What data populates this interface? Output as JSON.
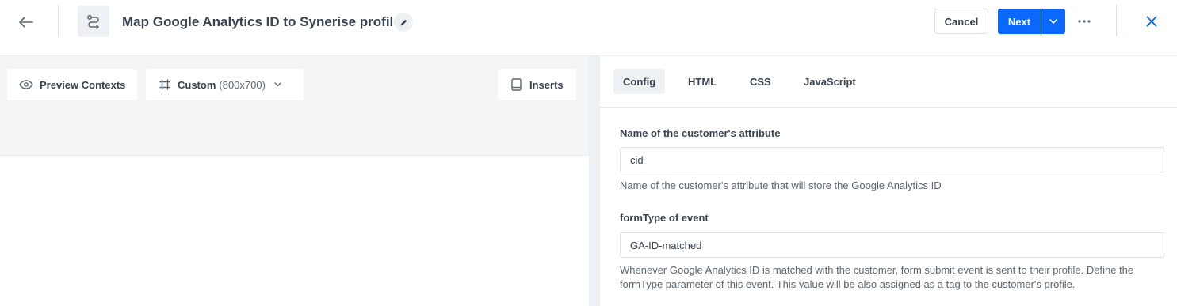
{
  "header": {
    "title": "Map Google Analytics ID to Synerise profile",
    "cancel_label": "Cancel",
    "next_label": "Next",
    "icons": {
      "back": "arrow-left-icon",
      "title": "route-icon",
      "edit": "pencil-icon",
      "next_dropdown": "chevron-down-icon",
      "more": "more-horizontal-icon",
      "close": "close-icon"
    }
  },
  "preview_toolbar": {
    "preview_contexts_label": "Preview Contexts",
    "device_label": "Custom",
    "device_size": "(800x700)",
    "inserts_label": "Inserts"
  },
  "tabs": [
    {
      "label": "Config",
      "active": true
    },
    {
      "label": "HTML",
      "active": false
    },
    {
      "label": "CSS",
      "active": false
    },
    {
      "label": "JavaScript",
      "active": false
    }
  ],
  "config": {
    "attribute_field": {
      "label": "Name of the customer's attribute",
      "value": "cid",
      "hint": "Name of the customer's attribute that will store the Google Analytics ID"
    },
    "formtype_field": {
      "label": "formType of event",
      "value": "GA-ID-matched",
      "hint": "Whenever Google Analytics ID is matched with the customer, form.submit event is sent to their profile. Define the formType parameter of this event. This value will be also assigned as a tag to the customer's profile."
    }
  },
  "colors": {
    "primary": "#0b68ff",
    "text": "#384350",
    "muted_text": "#5a6670",
    "border": "#dbe0e3",
    "panel_bg": "#f4f5f6"
  }
}
